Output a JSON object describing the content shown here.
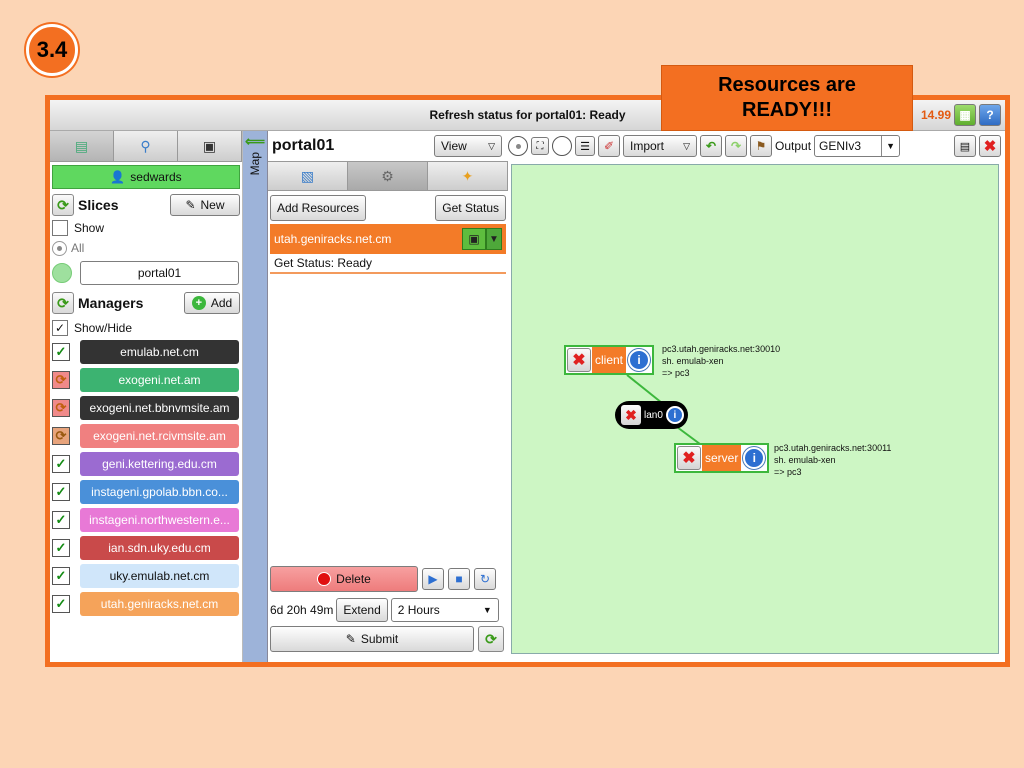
{
  "slide": {
    "number": "3.4"
  },
  "banner": {
    "line1": "Resources are",
    "line2": "READY!!!"
  },
  "titlebar": {
    "title": "Refresh status for portal01: Ready",
    "version": "14.99"
  },
  "sidebar": {
    "user": "sedwards",
    "slices": {
      "title": "Slices",
      "new_label": "New",
      "show_label": "Show",
      "all_label": "All",
      "slice_name": "portal01"
    },
    "managers": {
      "title": "Managers",
      "add_label": "Add",
      "showhide_label": "Show/Hide",
      "items": [
        {
          "label": "emulab.net.cm",
          "bg": "#333333",
          "fg": "#ffffff",
          "status": "ok"
        },
        {
          "label": "exogeni.net.am",
          "bg": "#3cb371",
          "fg": "#ffffff",
          "status": "warn"
        },
        {
          "label": "exogeni.net.bbnvmsite.am",
          "bg": "#333333",
          "fg": "#ffffff",
          "status": "warn"
        },
        {
          "label": "exogeni.net.rcivmsite.am",
          "bg": "#f08080",
          "fg": "#ffffff",
          "status": "warn2"
        },
        {
          "label": "geni.kettering.edu.cm",
          "bg": "#9b6bd1",
          "fg": "#ffffff",
          "status": "ok"
        },
        {
          "label": "instageni.gpolab.bbn.co...",
          "bg": "#4a90d9",
          "fg": "#ffffff",
          "status": "ok"
        },
        {
          "label": "instageni.northwestern.e...",
          "bg": "#e879d6",
          "fg": "#ffffff",
          "status": "ok"
        },
        {
          "label": "ian.sdn.uky.edu.cm",
          "bg": "#c94a4a",
          "fg": "#ffffff",
          "status": "ok"
        },
        {
          "label": "uky.emulab.net.cm",
          "bg": "#d0e6fa",
          "fg": "#111111",
          "status": "ok"
        },
        {
          "label": "utah.geniracks.net.cm",
          "bg": "#f5a35a",
          "fg": "#ffffff",
          "status": "ok"
        }
      ]
    }
  },
  "map_strip": {
    "label": "Map"
  },
  "mid": {
    "slice_title": "portal01",
    "view_label": "View",
    "add_resources_label": "Add Resources",
    "get_status_label": "Get Status",
    "selected_manager": "utah.geniracks.net.cm",
    "status_text": "Get Status: Ready",
    "delete_label": "Delete",
    "expiry": "6d 20h 49m",
    "extend_label": "Extend",
    "extend_duration": "2 Hours",
    "submit_label": "Submit"
  },
  "toolbar": {
    "import_label": "Import",
    "output_label": "Output",
    "output_format": "GENIv3"
  },
  "canvas": {
    "client": {
      "label": "client",
      "info": [
        "pc3.utah.geniracks.net:30010",
        "sh. emulab-xen",
        "=> pc3"
      ]
    },
    "lan": {
      "label": "lan0"
    },
    "server": {
      "label": "server",
      "info": [
        "pc3.utah.geniracks.net:30011",
        "sh. emulab-xen",
        "=> pc3"
      ]
    }
  },
  "colors": {
    "accent": "#f36f21",
    "canvas_bg": "#cdf6c4",
    "link": "#3cb73c"
  }
}
